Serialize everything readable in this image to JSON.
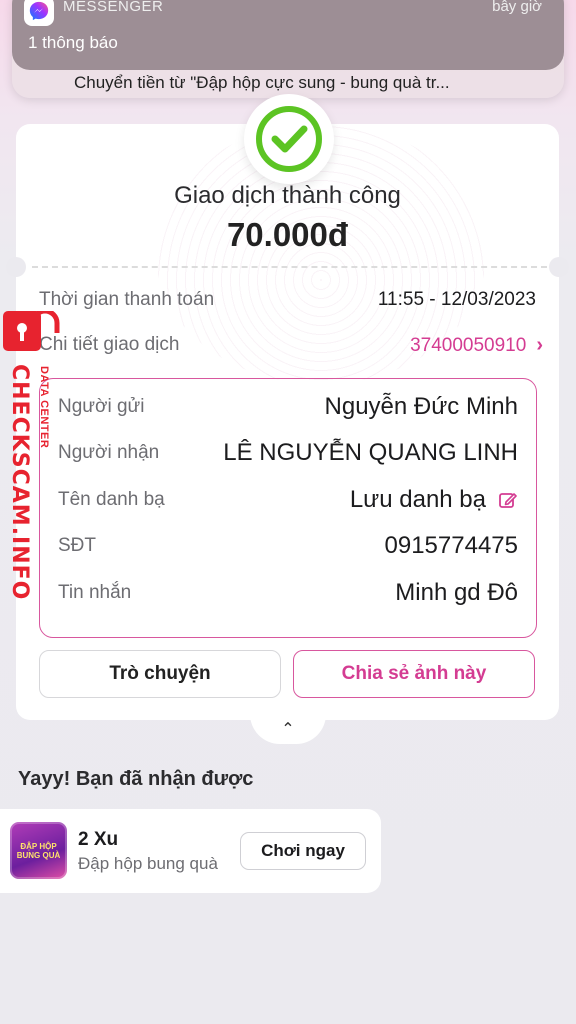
{
  "notification": {
    "app_name": "MESSENGER",
    "time": "bây giờ",
    "count_text": "1 thông báo",
    "preview": "Chuyển tiền từ \"Đập hộp cực sung - bung quà tr..."
  },
  "receipt": {
    "status": "Giao dịch thành công",
    "amount": "70.000đ",
    "payment_time_label": "Thời gian thanh toán",
    "payment_time_value": "11:55 - 12/03/2023",
    "transaction_detail_label": "Chi tiết giao dịch",
    "transaction_id": "37400050910",
    "details": {
      "sender_label": "Người gửi",
      "sender_value": "Nguyễn Đức Minh",
      "receiver_label": "Người nhận",
      "receiver_value": "LÊ NGUYỄN QUANG LINH",
      "contact_label": "Tên danh bạ",
      "contact_value": "Lưu danh bạ",
      "phone_label": "SĐT",
      "phone_value": "0915774475",
      "message_label": "Tin nhắn",
      "message_value": "Minh gd Đô"
    },
    "chat_button": "Trò chuyện",
    "share_button": "Chia sẻ ảnh này"
  },
  "rewards": {
    "title": "Yayy! Bạn đã nhận được",
    "item_name": "2 Xu",
    "item_sub": "Đập hộp bung quà",
    "item_image_text": "ĐẬP HỘP BUNG QUÀ",
    "play_button": "Chơi ngay"
  },
  "overlay": {
    "brand": "CHECKSCAM.INFO",
    "sub": "DATA CENTER"
  },
  "colors": {
    "accent_pink": "#d43c92",
    "success_green": "#5cc423",
    "overlay_red": "#e7232f"
  }
}
